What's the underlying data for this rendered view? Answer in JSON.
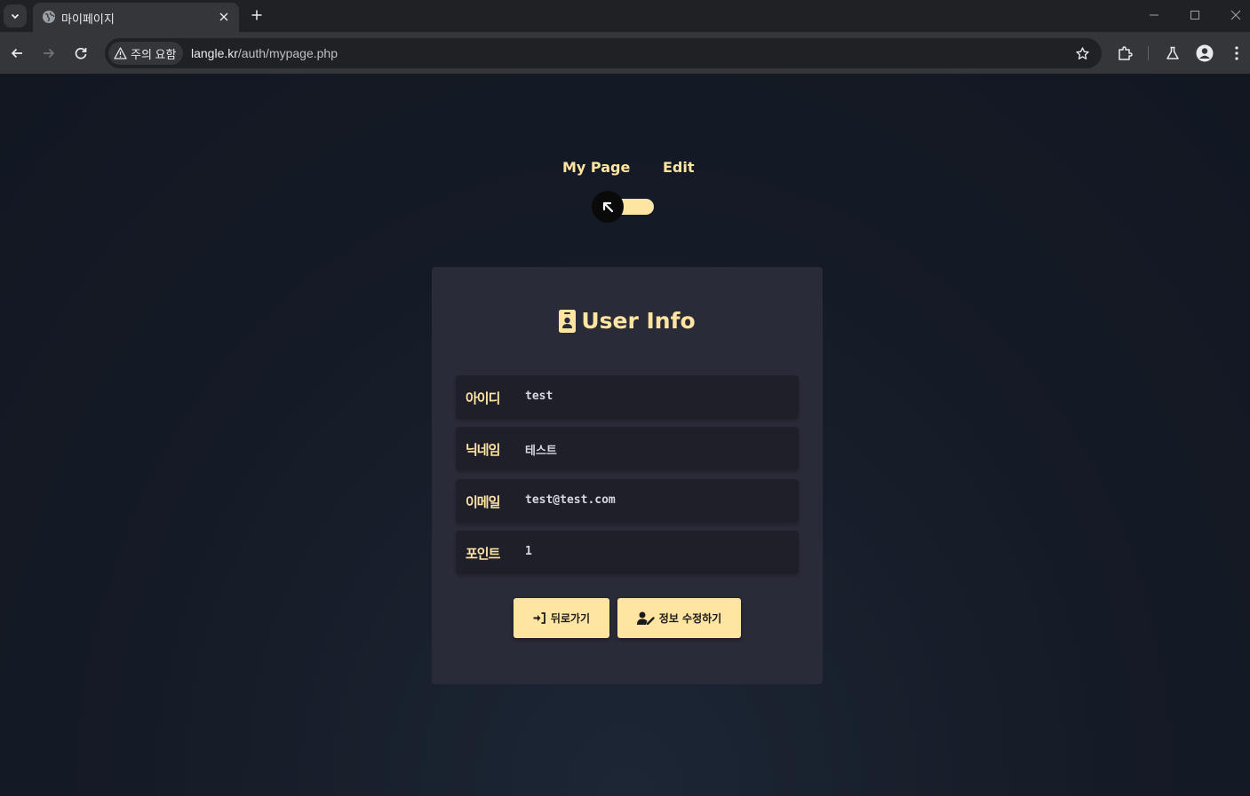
{
  "browser": {
    "tab_title": "마이페이지",
    "security_label": "주의 요함",
    "url_host": "langle.kr",
    "url_path": "/auth/mypage.php"
  },
  "header": {
    "mode_left": "My Page",
    "mode_right": "Edit",
    "toggle_state": "my-page"
  },
  "card": {
    "title": "User Info",
    "title_icon": "id-badge-icon",
    "rows": [
      {
        "label": "아이디",
        "value": "test"
      },
      {
        "label": "닉네임",
        "value": "테스트"
      },
      {
        "label": "이메일",
        "value": "test@test.com"
      },
      {
        "label": "포인트",
        "value": "1"
      }
    ]
  },
  "actions": {
    "back_label": "뒤로가기",
    "back_icon": "sign-in-icon",
    "edit_label": "정보 수정하기",
    "edit_icon": "user-pen-icon"
  },
  "colors": {
    "accent": "#ffe5a1",
    "card_bg": "#2a2b38",
    "row_bg": "#1f1f2a",
    "page_bg": "#151b26"
  }
}
